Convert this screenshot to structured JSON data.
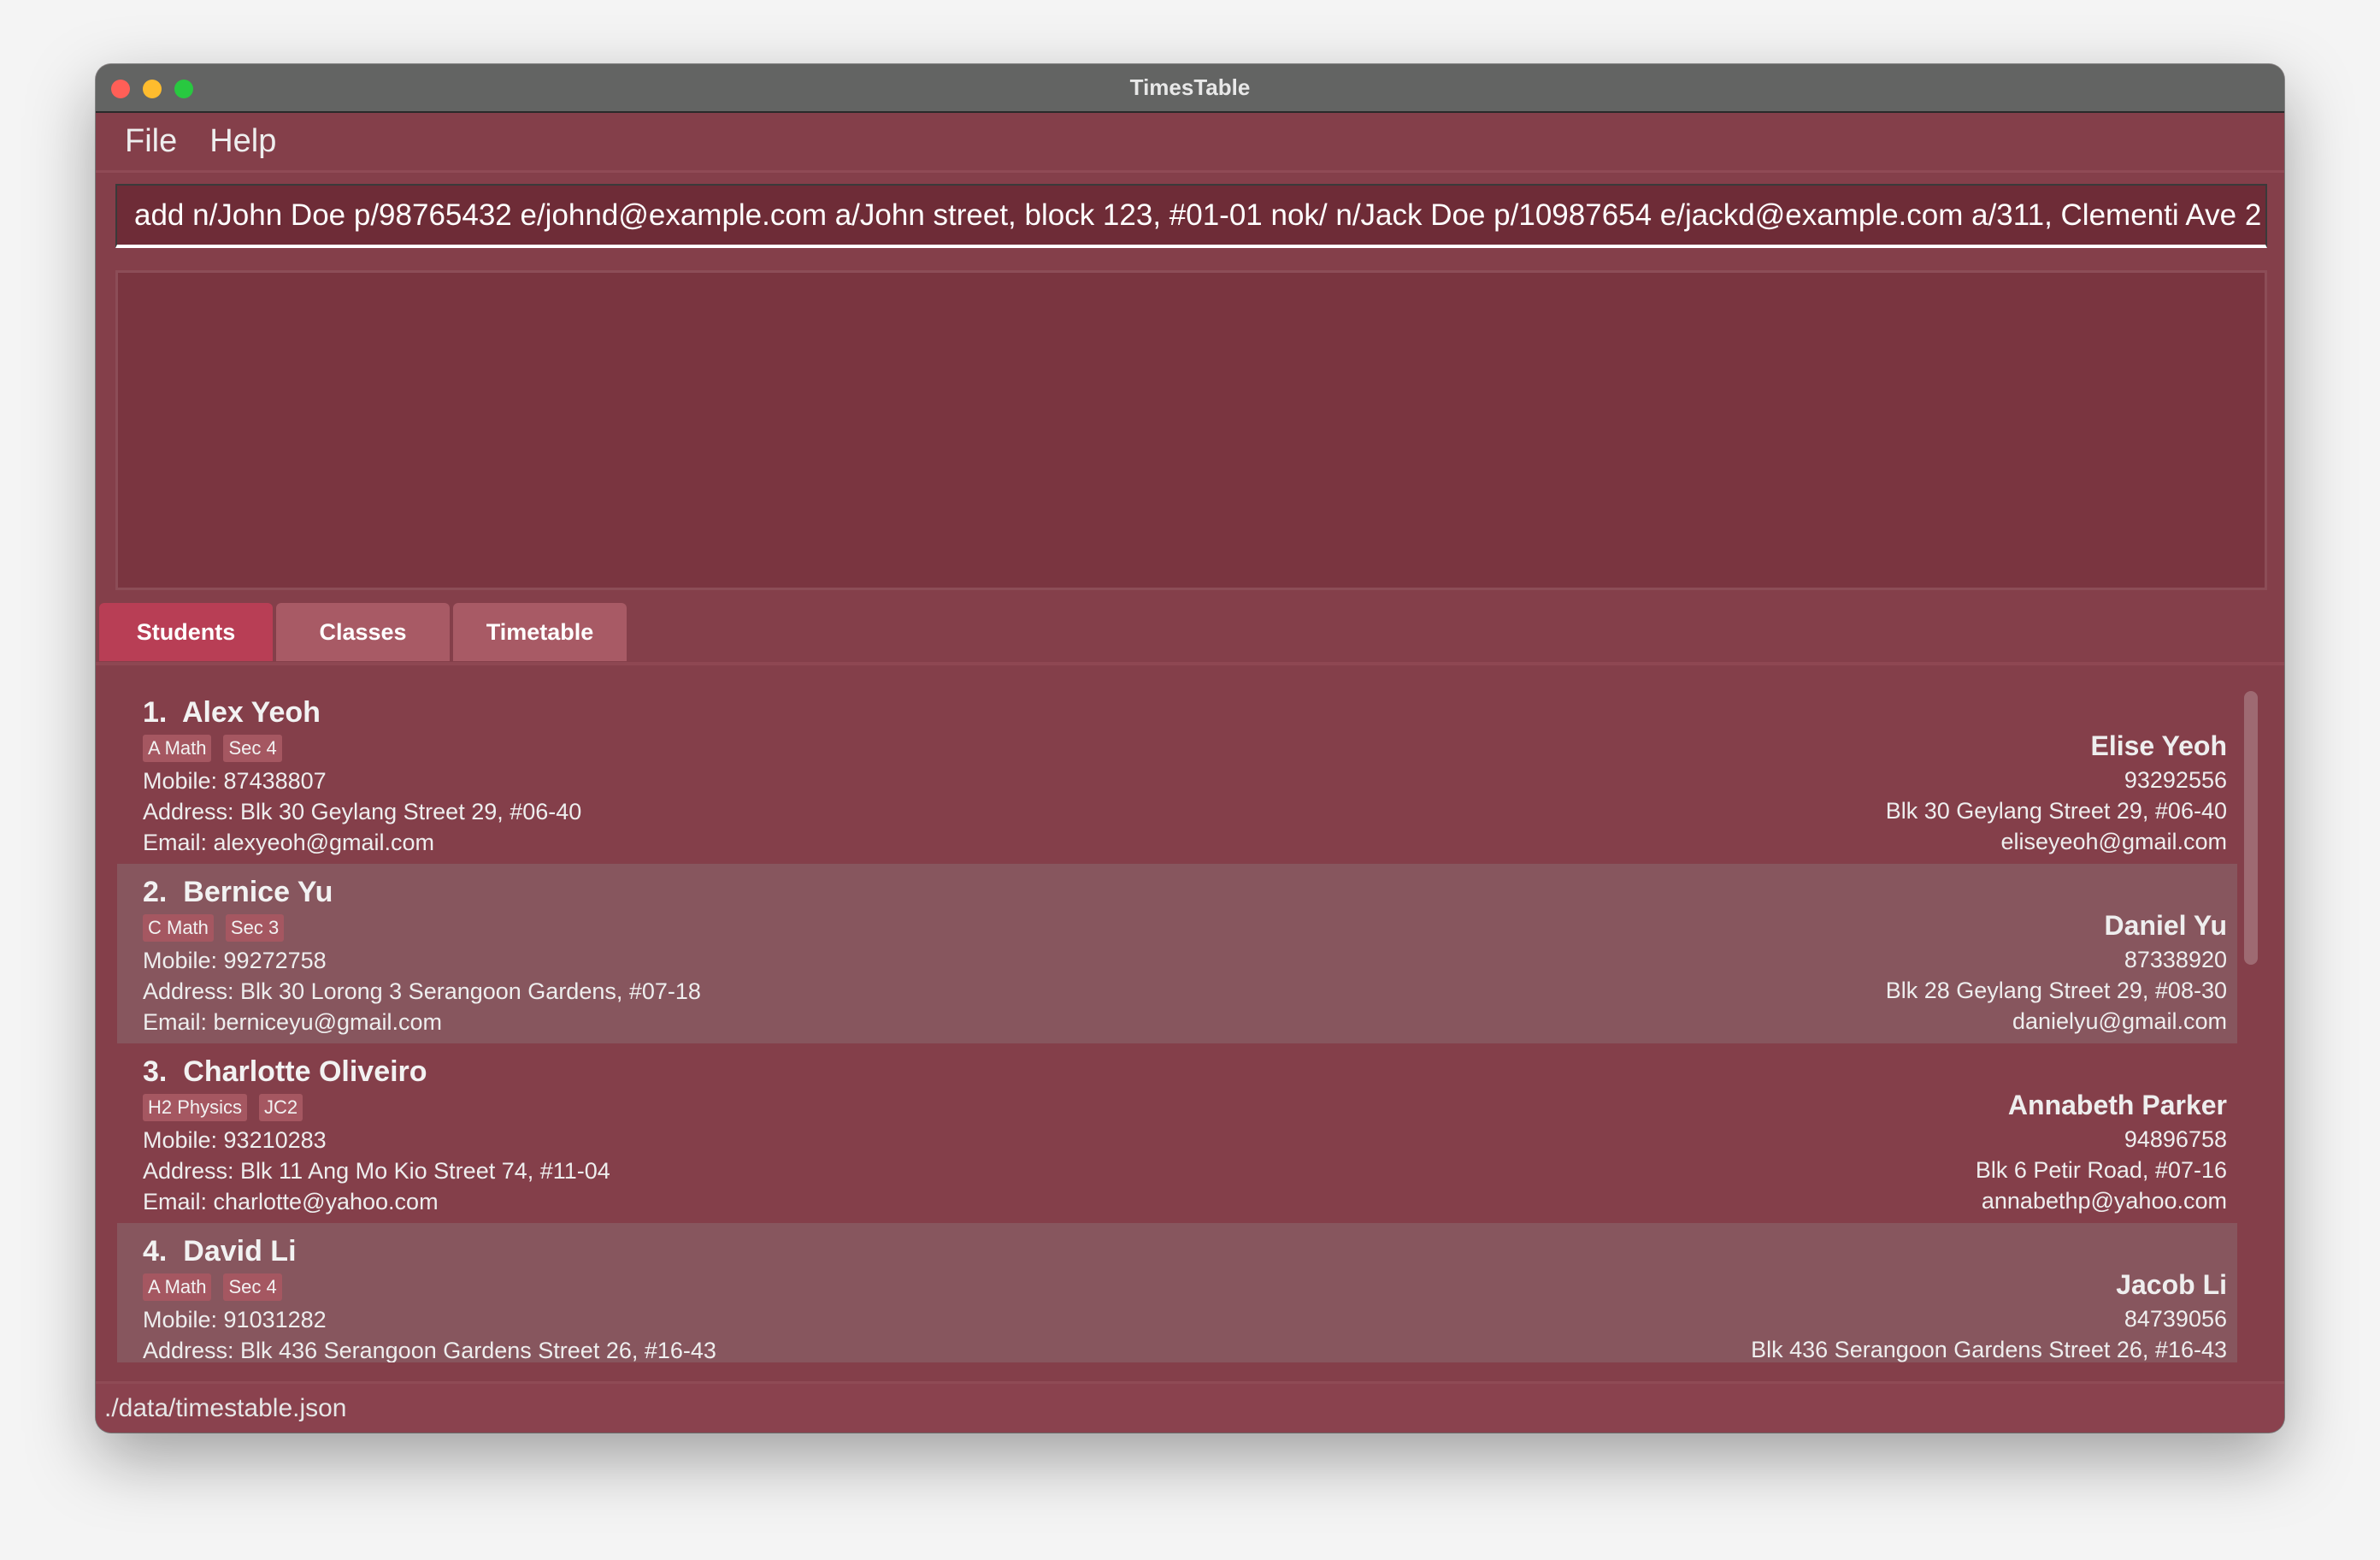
{
  "window": {
    "title": "TimesTable",
    "controls": {
      "close": "#ff5f57",
      "minimize": "#febc2e",
      "zoom": "#28c840"
    }
  },
  "menu": {
    "items": [
      "File",
      "Help"
    ]
  },
  "command": {
    "value": "add n/John Doe p/98765432 e/johnd@example.com a/John street, block 123, #01-01 nok/ n/Jack Doe p/10987654 e/jackd@example.com a/311, Clementi Ave 2"
  },
  "result": {
    "text": ""
  },
  "tabs": [
    {
      "label": "Students",
      "active": true
    },
    {
      "label": "Classes",
      "active": false
    },
    {
      "label": "Timetable",
      "active": false
    }
  ],
  "students": [
    {
      "index": "1.",
      "name": "Alex Yeoh",
      "tags": [
        "A Math",
        "Sec 4"
      ],
      "mobile": "Mobile: 87438807",
      "address": "Address: Blk 30 Geylang Street 29, #06-40",
      "email": "Email: alexyeoh@gmail.com",
      "nok": {
        "name": "Elise Yeoh",
        "phone": "93292556",
        "address": "Blk 30 Geylang Street 29, #06-40",
        "email": "eliseyeoh@gmail.com"
      }
    },
    {
      "index": "2.",
      "name": "Bernice Yu",
      "tags": [
        "C Math",
        "Sec 3"
      ],
      "mobile": "Mobile: 99272758",
      "address": "Address: Blk 30 Lorong 3 Serangoon Gardens, #07-18",
      "email": "Email: berniceyu@gmail.com",
      "nok": {
        "name": "Daniel Yu",
        "phone": "87338920",
        "address": "Blk 28 Geylang Street 29, #08-30",
        "email": "danielyu@gmail.com"
      }
    },
    {
      "index": "3.",
      "name": "Charlotte Oliveiro",
      "tags": [
        "H2 Physics",
        "JC2"
      ],
      "mobile": "Mobile: 93210283",
      "address": "Address: Blk 11 Ang Mo Kio Street 74, #11-04",
      "email": "Email: charlotte@yahoo.com",
      "nok": {
        "name": "Annabeth Parker",
        "phone": "94896758",
        "address": "Blk 6 Petir Road, #07-16",
        "email": "annabethp@yahoo.com"
      }
    },
    {
      "index": "4.",
      "name": "David Li",
      "tags": [
        "A Math",
        "Sec 4"
      ],
      "mobile": "Mobile: 91031282",
      "address": "Address: Blk 436 Serangoon Gardens Street 26, #16-43",
      "email": "",
      "nok": {
        "name": "Jacob Li",
        "phone": "84739056",
        "address": "Blk 436 Serangoon Gardens Street 26, #16-43",
        "email": ""
      }
    }
  ],
  "status": {
    "path": "./data/timestable.json"
  }
}
